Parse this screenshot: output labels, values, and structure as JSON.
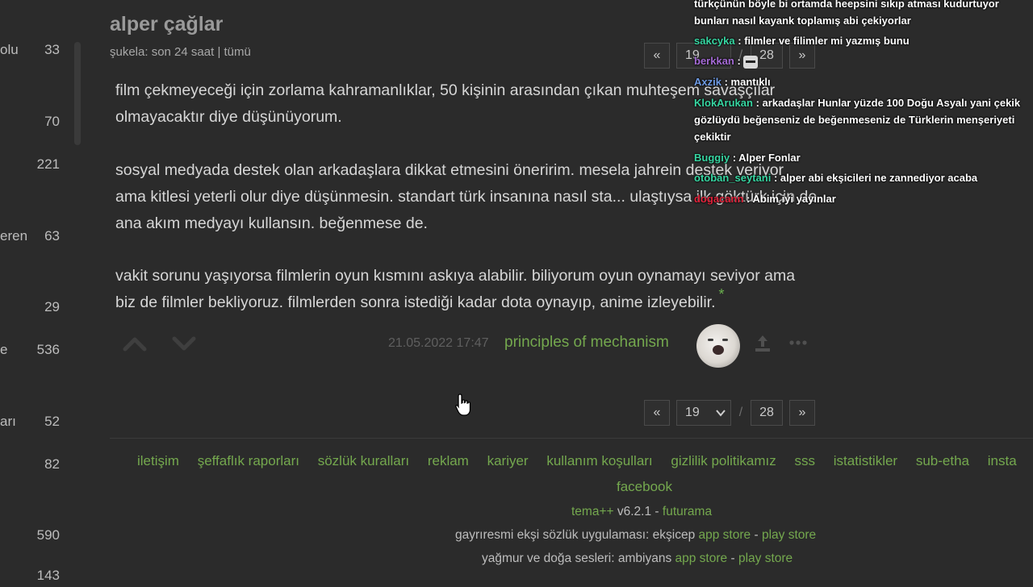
{
  "sidebar": {
    "rows": [
      {
        "label": "olu",
        "count": "33"
      },
      {
        "label": "",
        "count": "70"
      },
      {
        "label": "",
        "count": "221"
      },
      {
        "label": "eren",
        "count": "63"
      },
      {
        "label": "",
        "count": "29"
      },
      {
        "label": "e",
        "count": "536"
      },
      {
        "label": "arı",
        "count": "52"
      },
      {
        "label": "",
        "count": "82"
      },
      {
        "label": "",
        "count": "590"
      },
      {
        "label": "",
        "count": "143"
      }
    ]
  },
  "topic": {
    "title": "alper çağlar",
    "subnav": {
      "sukela": "şukela:",
      "range": "son 24 saat",
      "sep": "|",
      "all": "tümü"
    }
  },
  "pager": {
    "prev": "«",
    "current": "19",
    "slash": "/",
    "last": "28",
    "next": "»"
  },
  "entry": {
    "paragraphs": [
      "film çekmeyeceği için zorlama kahramanlıklar, 50 kişinin arasından çıkan muhteşem savaşçılar olmayacaktır diye düşünüyorum.",
      "sosyal medyada destek olan arkadaşlara dikkat etmesini öneririm. mesela jahrein destek veriyor ama kitlesi yeterli olur diye düşünmesin. standart türk insanına nasıl sta... ulaştıysa ilk göktürk için de ana akım medyayı kullansın. beğenmese de.",
      "vakit sorunu yaşıyorsa filmlerin oyun kısmını askıya alabilir. biliyorum oyun oynamayı seviyor ama biz de filmler bekliyoruz. filmlerden sonra istediği kadar dota oynayıp, anime izleyebilir."
    ],
    "star": "*",
    "date": "21.05.2022 17:47",
    "author": "principles of mechanism"
  },
  "footer": {
    "links": [
      "iletişim",
      "şeffaflık raporları",
      "sözlük kuralları",
      "reklam",
      "kariyer",
      "kullanım koşulları",
      "gizlilik politikamız",
      "sss",
      "istatistikler",
      "sub-etha",
      "insta"
    ],
    "facebook": "facebook",
    "theme": {
      "name": "tema++",
      "version": "v6.2.1",
      "dash": "-",
      "skin": "futurama"
    },
    "app": {
      "text": "gayrıresmi ekşi sözlük uygulaması: ekşicep",
      "appstore": "app store",
      "dash": "-",
      "playstore": "play store"
    },
    "ambiyans": {
      "text": "yağmur ve doğa sesleri: ambiyans",
      "appstore": "app store",
      "dash": "-",
      "playstore": "play store"
    }
  },
  "chat": {
    "messages": [
      {
        "user": "",
        "color": "#ffffff",
        "text": "türkçünün böyle bi ortamda heepsini sıkıp atması kudurtuyor"
      },
      {
        "user": "",
        "color": "#ffffff",
        "text": "bunları nasıl kayank toplamış abi çekiyorlar"
      },
      {
        "user": "sakcyka",
        "color": "#37d6a2",
        "text": ": filmler ve filimler mi yazmış bunu"
      },
      {
        "user": "berkkan",
        "color": "#a56bd6",
        "text": ":"
      },
      {
        "user": "Axzik",
        "color": "#6f9ce6",
        "text": ": mantıklı"
      },
      {
        "user": "KlokArukan",
        "color": "#37d6a2",
        "text": ": arkadaşlar Hunlar yüzde 100 Doğu Asyalı yani çekik gözlüydü beğenseniz de beğenmeseniz de Türklerin menşeriyeti çekiktir"
      },
      {
        "user": "Buggiy",
        "color": "#37d6a2",
        "text": ": Alper Fonlar"
      },
      {
        "user": "otoban_seytani",
        "color": "#37d6a2",
        "text": ": alper abi ekşicileri ne zannediyor acaba"
      },
      {
        "user": "dogacann",
        "color": "#e0223a",
        "text": ": Abim iyi yayınlar"
      }
    ]
  }
}
